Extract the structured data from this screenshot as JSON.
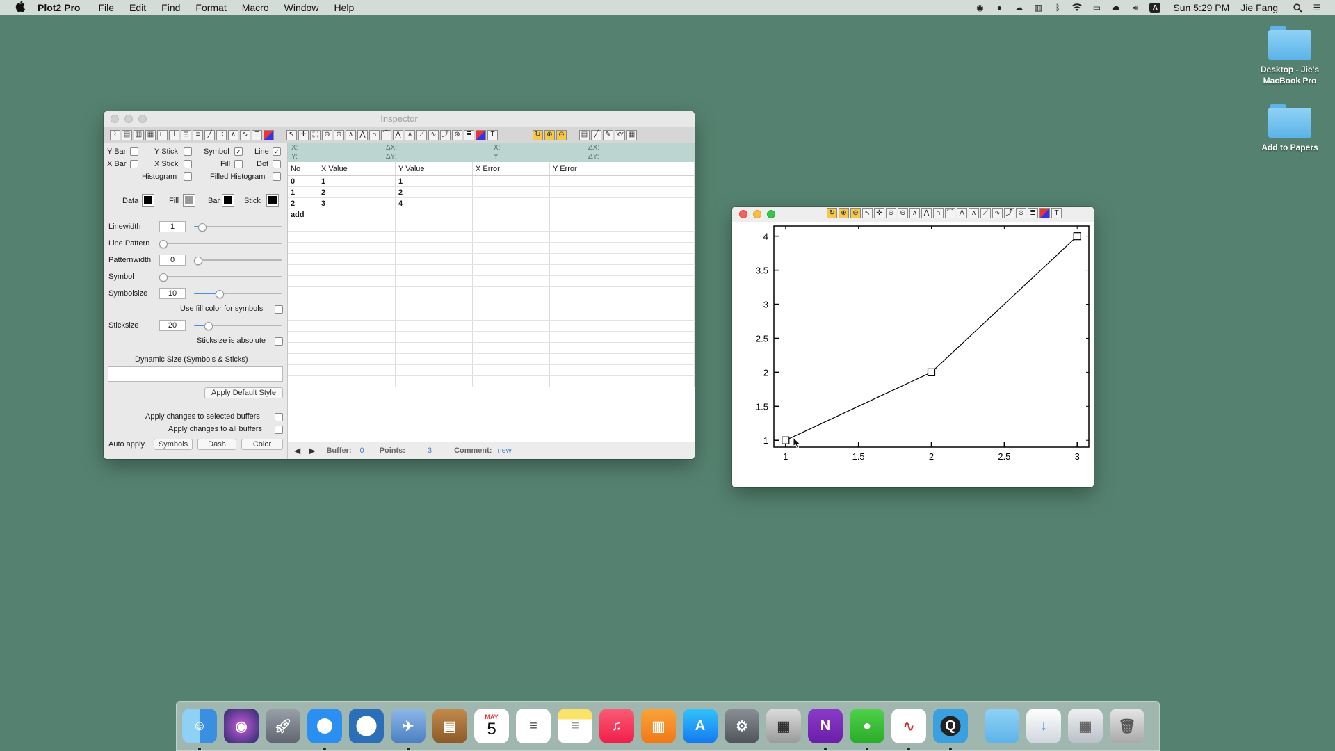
{
  "menubar": {
    "app_name": "Plot2 Pro",
    "items": [
      "File",
      "Edit",
      "Find",
      "Format",
      "Macro",
      "Window",
      "Help"
    ],
    "clock": "Sun 5:29 PM",
    "user": "Jie Fang",
    "input_source": "A"
  },
  "desktop": {
    "items": [
      {
        "label": "Desktop - Jie's MacBook Pro"
      },
      {
        "label": "Add to Papers"
      }
    ]
  },
  "inspector": {
    "title": "Inspector",
    "checkboxes": {
      "y_bar": "Y Bar",
      "y_stick": "Y Stick",
      "symbol": "Symbol",
      "line": "Line",
      "x_bar": "X Bar",
      "x_stick": "X Stick",
      "fill": "Fill",
      "dot": "Dot",
      "histogram": "Histogram",
      "filled_histogram": "Filled Histogram"
    },
    "colors": {
      "data_label": "Data",
      "fill_label": "Fill",
      "bar_label": "Bar",
      "stick_label": "Stick",
      "data_color": "#000000",
      "fill_color": "#9a9a9a",
      "bar_color": "#000000",
      "stick_color": "#000000"
    },
    "linewidth": {
      "label": "Linewidth",
      "value": "1",
      "level": 0.05
    },
    "line_pattern": {
      "label": "Line Pattern",
      "level": 0
    },
    "patternwidth": {
      "label": "Patternwidth",
      "value": "0",
      "level": 0
    },
    "symbol": {
      "label": "Symbol",
      "level": 0
    },
    "symbolsize": {
      "label": "Symbolsize",
      "value": "10",
      "level": 0.27
    },
    "use_fill_color": "Use fill color for symbols",
    "sticksize": {
      "label": "Sticksize",
      "value": "20",
      "level": 0.13
    },
    "sticksize_absolute": "Sticksize is absolute",
    "dynamic_size": "Dynamic Size  (Symbols & Sticks)",
    "apply_default_style": "Apply Default Style",
    "apply_selected": "Apply changes to selected buffers",
    "apply_all": "Apply changes to all buffers",
    "auto_apply": "Auto apply",
    "auto_buttons": [
      "Symbols",
      "Dash",
      "Color"
    ],
    "coord": {
      "x": "X:",
      "y": "Y:",
      "dx": "ΔX:",
      "dy": "ΔY:"
    },
    "table": {
      "headers": [
        "No",
        "X Value",
        "Y Value",
        "X Error",
        "Y Error"
      ],
      "rows": [
        [
          "0",
          "1",
          "1",
          "",
          ""
        ],
        [
          "1",
          "2",
          "2",
          "",
          ""
        ],
        [
          "2",
          "3",
          "4",
          "",
          ""
        ]
      ],
      "add_label": "add"
    },
    "status": {
      "buffer_label": "Buffer:",
      "buffer_value": "0",
      "points_label": "Points:",
      "points_value": "3",
      "comment_label": "Comment:",
      "comment_value": "new"
    }
  },
  "chart_data": {
    "type": "line",
    "x": [
      1,
      2,
      3
    ],
    "series": [
      {
        "values": [
          1,
          2,
          4
        ],
        "marker": "square",
        "color": "#000000"
      }
    ],
    "xlim": [
      0.92,
      3.08
    ],
    "ylim": [
      0.9,
      4.15
    ],
    "xticks": [
      "1",
      "1.5",
      "2",
      "2.5",
      "3"
    ],
    "yticks": [
      "1",
      "1.5",
      "2",
      "2.5",
      "3",
      "3.5",
      "4"
    ],
    "title": "",
    "xlabel": "",
    "ylabel": "",
    "grid": false
  },
  "dock": {
    "apps": [
      "Finder",
      "Siri",
      "Launchpad",
      "Safari",
      "Scholar",
      "Preview",
      "Books",
      "Calendar",
      "Reminders",
      "Notes",
      "Music",
      "iBooks",
      "App Store",
      "System Preferences",
      "Utility",
      "OneNote",
      "WeChat",
      "Plot2",
      "QuickTime",
      "Folder",
      "Downloads",
      "Screenshots",
      "Trash"
    ],
    "calendar_month": "MAY",
    "calendar_day": "5"
  }
}
